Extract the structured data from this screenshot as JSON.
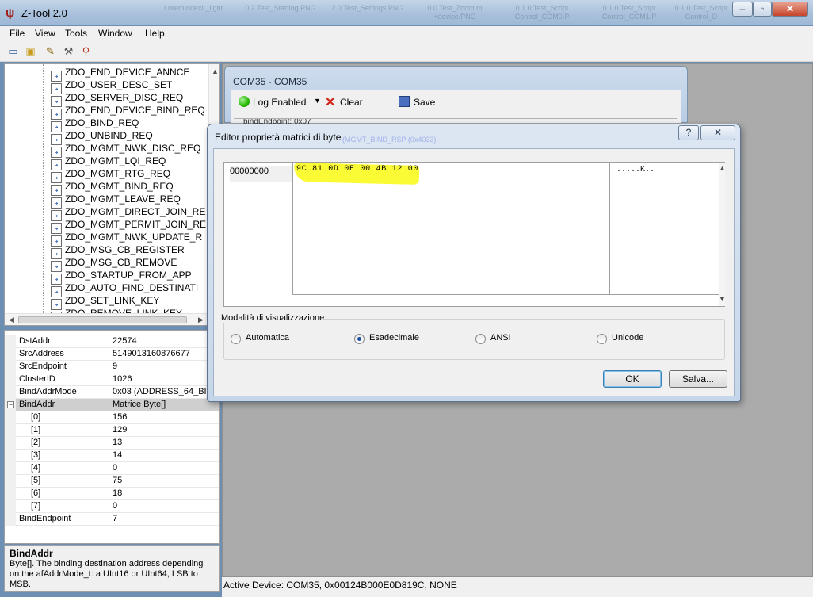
{
  "app": {
    "title": "Z-Tool 2.0",
    "icon": "ti-logo-icon",
    "background_tabs": [
      "LoremIndexL_light",
      "0.2 Test_Starting PNG",
      "2.0 Test_Settings PNG",
      "0.0 Test_Zoom m +device.PNG",
      "0.1.0 Test_Script Control_COM0.P",
      "0.1.0 Test_Script Control_COM1.P",
      "0.1.0 Test_Script Control_D"
    ],
    "caption_buttons": {
      "minimize": "–",
      "restore": "▫",
      "close": "✕"
    }
  },
  "menu": [
    "File",
    "View",
    "Tools",
    "Window",
    "Help"
  ],
  "toolbar_icons": [
    "open-icon",
    "device-config-icon",
    "script-icon",
    "tools-icon",
    "search-device-icon"
  ],
  "tree": {
    "items": [
      "ZDO_END_DEVICE_ANNCE",
      "ZDO_USER_DESC_SET",
      "ZDO_SERVER_DISC_REQ",
      "ZDO_END_DEVICE_BIND_REQ",
      "ZDO_BIND_REQ",
      "ZDO_UNBIND_REQ",
      "ZDO_MGMT_NWK_DISC_REQ",
      "ZDO_MGMT_LQI_REQ",
      "ZDO_MGMT_RTG_REQ",
      "ZDO_MGMT_BIND_REQ",
      "ZDO_MGMT_LEAVE_REQ",
      "ZDO_MGMT_DIRECT_JOIN_RE",
      "ZDO_MGMT_PERMIT_JOIN_RE",
      "ZDO_MGMT_NWK_UPDATE_R",
      "ZDO_MSG_CB_REGISTER",
      "ZDO_MSG_CB_REMOVE",
      "ZDO_STARTUP_FROM_APP",
      "ZDO_AUTO_FIND_DESTINATI",
      "ZDO_SET_LINK_KEY",
      "ZDO_REMOVE_LINK_KEY"
    ],
    "item_icon": "command-icon"
  },
  "properties": [
    {
      "name": "DstAddr",
      "value": "22574"
    },
    {
      "name": "SrcAddress",
      "value": "5149013160876677"
    },
    {
      "name": "SrcEndpoint",
      "value": "9"
    },
    {
      "name": "ClusterID",
      "value": "1026"
    },
    {
      "name": "BindAddrMode",
      "value": "0x03 (ADDRESS_64_BIT)"
    },
    {
      "name": "BindAddr",
      "value": "Matrice Byte[]",
      "expanded": true
    },
    {
      "name": "[0]",
      "value": "156",
      "child": true
    },
    {
      "name": "[1]",
      "value": "129",
      "child": true
    },
    {
      "name": "[2]",
      "value": "13",
      "child": true
    },
    {
      "name": "[3]",
      "value": "14",
      "child": true
    },
    {
      "name": "[4]",
      "value": "0",
      "child": true
    },
    {
      "name": "[5]",
      "value": "75",
      "child": true
    },
    {
      "name": "[6]",
      "value": "18",
      "child": true
    },
    {
      "name": "[7]",
      "value": "0",
      "child": true
    },
    {
      "name": "BindEndpoint",
      "value": "7"
    }
  ],
  "help": {
    "title": "BindAddr",
    "text": "Byte[].  The binding destination address depending on the afAddrMode_t: a UInt16 or UInt64, LSB to MSB."
  },
  "com_window": {
    "title": "COM35 - COM35",
    "log_label": "Log Enabled",
    "clear_label": "Clear",
    "save_label": "Save",
    "log_line": "bindEndpoint: 0x07"
  },
  "dialog": {
    "title": "Editor proprietà matrici di byte",
    "ghost_text": "(MGMT_BIND_RSP (0x4033)",
    "help_btn": "?",
    "close_btn": "✕",
    "offset": "00000000",
    "bytes": "9C 81 0D 0E 00 4B 12 00",
    "ascii": ".....K..",
    "mode_label": "Modalità di visualizzazione",
    "modes": [
      "Automatica",
      "Esadecimale",
      "ANSI",
      "Unicode"
    ],
    "selected_mode": "Esadecimale",
    "ok_label": "OK",
    "salva_label": "Salva...",
    "highlight_color": "#fbfb35"
  },
  "status": {
    "text": "Active Device: COM35, 0x00124B000E0D819C, NONE"
  }
}
